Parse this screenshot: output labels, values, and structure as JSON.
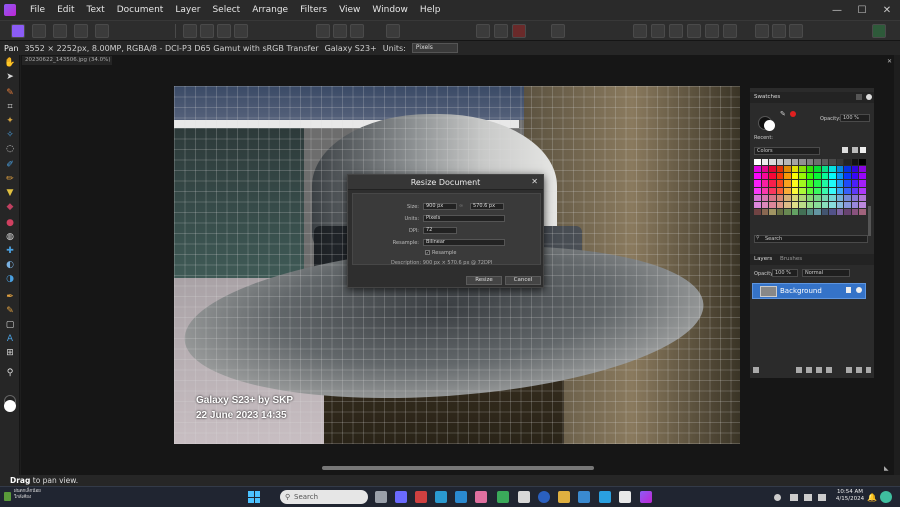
{
  "menubar": {
    "items": [
      "File",
      "Edit",
      "Text",
      "Document",
      "Layer",
      "Select",
      "Arrange",
      "Filters",
      "View",
      "Window",
      "Help"
    ]
  },
  "contextbar": {
    "tool": "Pan",
    "info": "3552 × 2252px, 8.00MP, RGBA/8 - DCI-P3 D65 Gamut with sRGB Transfer",
    "device": "Galaxy S23+",
    "units_label": "Units:",
    "units_value": "Pixels"
  },
  "document": {
    "tab": "20230622_143506.jpg (34.0%)",
    "watermark_line1": "Galaxy S23+ by SKP",
    "watermark_line2": "22 June 2023 14:35"
  },
  "dialog": {
    "title": "Resize Document",
    "size_label": "Size:",
    "width_value": "900 px",
    "height_value": "570.6 px",
    "units_label": "Units:",
    "units_value": "Pixels",
    "dpi_label": "DPI:",
    "dpi_value": "72",
    "resample_label": "Resample:",
    "resample_value": "Bilinear",
    "resample_check_label": "Resample",
    "description": "Description: 900 px × 570.6 px @ 72DPI",
    "resize_button": "Resize",
    "cancel_button": "Cancel"
  },
  "swatches": {
    "tab_label": "Swatches",
    "opacity_label": "Opacity:",
    "opacity_value": "100 %",
    "recent_label": "Recent:",
    "palette_label": "Colors",
    "search_placeholder": "Search"
  },
  "layers": {
    "tab_layers": "Layers",
    "tab_brushes": "Brushes",
    "opacity_label": "Opacity:",
    "opacity_value": "100 %",
    "blend_mode": "Normal",
    "layer_name": "Background"
  },
  "statusbar": {
    "bold": "Drag",
    "text": "to pan view."
  },
  "taskbar": {
    "weather_line1": "ฝนตกเล็กน้อย",
    "weather_line2": "ใกล้เคียง",
    "search_placeholder": "Search",
    "time": "10:54 AM",
    "date": "4/15/2024"
  },
  "colors": {
    "accent": "#3573c8",
    "app_bg": "#1e1e1e",
    "taskbar_bg": "#202531"
  }
}
